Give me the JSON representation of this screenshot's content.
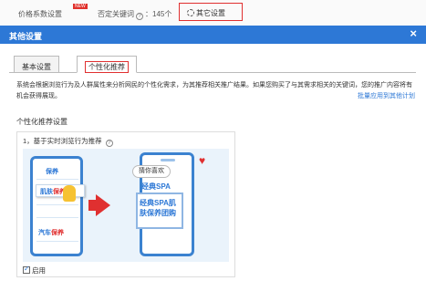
{
  "toolbar": {
    "bid_settings": "价格系数设置",
    "new_badge": "NEW",
    "negative_keywords": "否定关键词",
    "negative_count": "：145个",
    "help_icon": "?",
    "other_settings": "其它设置"
  },
  "dialog": {
    "title": "其他设置",
    "close": "×",
    "tabs": [
      {
        "label": "基本设置",
        "active": false
      },
      {
        "label": "个性化推荐",
        "active": true
      }
    ],
    "description": "系统会根据浏览行为及人群属性来分析网民的个性化需求，为其推荐相关推广结果。如果您购买了与其需求相关的关键词，您的推广内容将有机会获得展现。",
    "apply_link": "批量应用到其他计划",
    "section_title": "个性化推荐设置",
    "panel_title": "1，基于实时浏览行为推荐",
    "panel_help": "?",
    "illustration": {
      "left_label_1": "保养",
      "left_chip_a": "肌肤",
      "left_chip_b": "保养",
      "left_label_2a": "汽车",
      "left_label_2b": "保养",
      "bubble": "猜你喜欢",
      "spa_top": "经典SPA",
      "ad_text": "经典SPA肌肤保养团购"
    },
    "enable_label": "启用",
    "enable_checked": true
  },
  "colors": {
    "header_blue": "#2d78d6",
    "highlight_red": "#e03030"
  }
}
